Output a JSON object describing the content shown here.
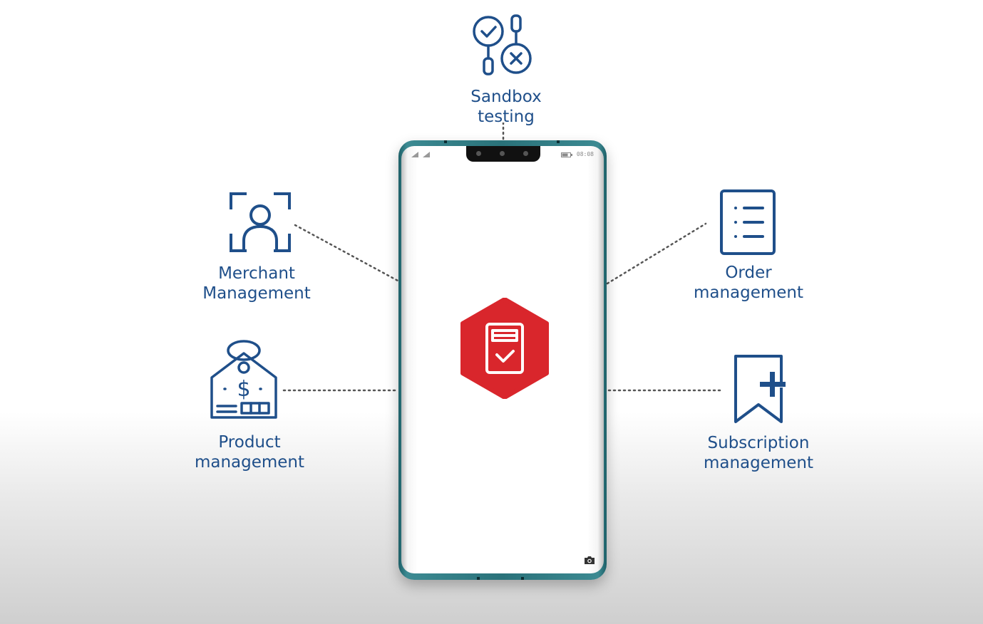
{
  "features": {
    "sandbox": {
      "label_line1": "Sandbox",
      "label_line2": "testing",
      "icon": "sandbox-testing-icon"
    },
    "merchant": {
      "label_line1": "Merchant",
      "label_line2": "Management",
      "icon": "merchant-user-icon"
    },
    "order": {
      "label_line1": "Order",
      "label_line2": "management",
      "icon": "order-list-icon"
    },
    "product": {
      "label_line1": "Product",
      "label_line2": "management",
      "icon": "price-tag-icon"
    },
    "subscription": {
      "label_line1": "Subscription",
      "label_line2": "management",
      "icon": "bookmark-plus-icon"
    }
  },
  "phone": {
    "status_time": "08:08",
    "app_icon": "payment-card-check-icon",
    "camera_icon": "camera-icon"
  },
  "colors": {
    "label_blue": "#1f4f8a",
    "icon_blue": "#1f4f8a",
    "app_red": "#d9262c",
    "phone_frame": "#2a727a",
    "connector": "#6b6b6b"
  }
}
